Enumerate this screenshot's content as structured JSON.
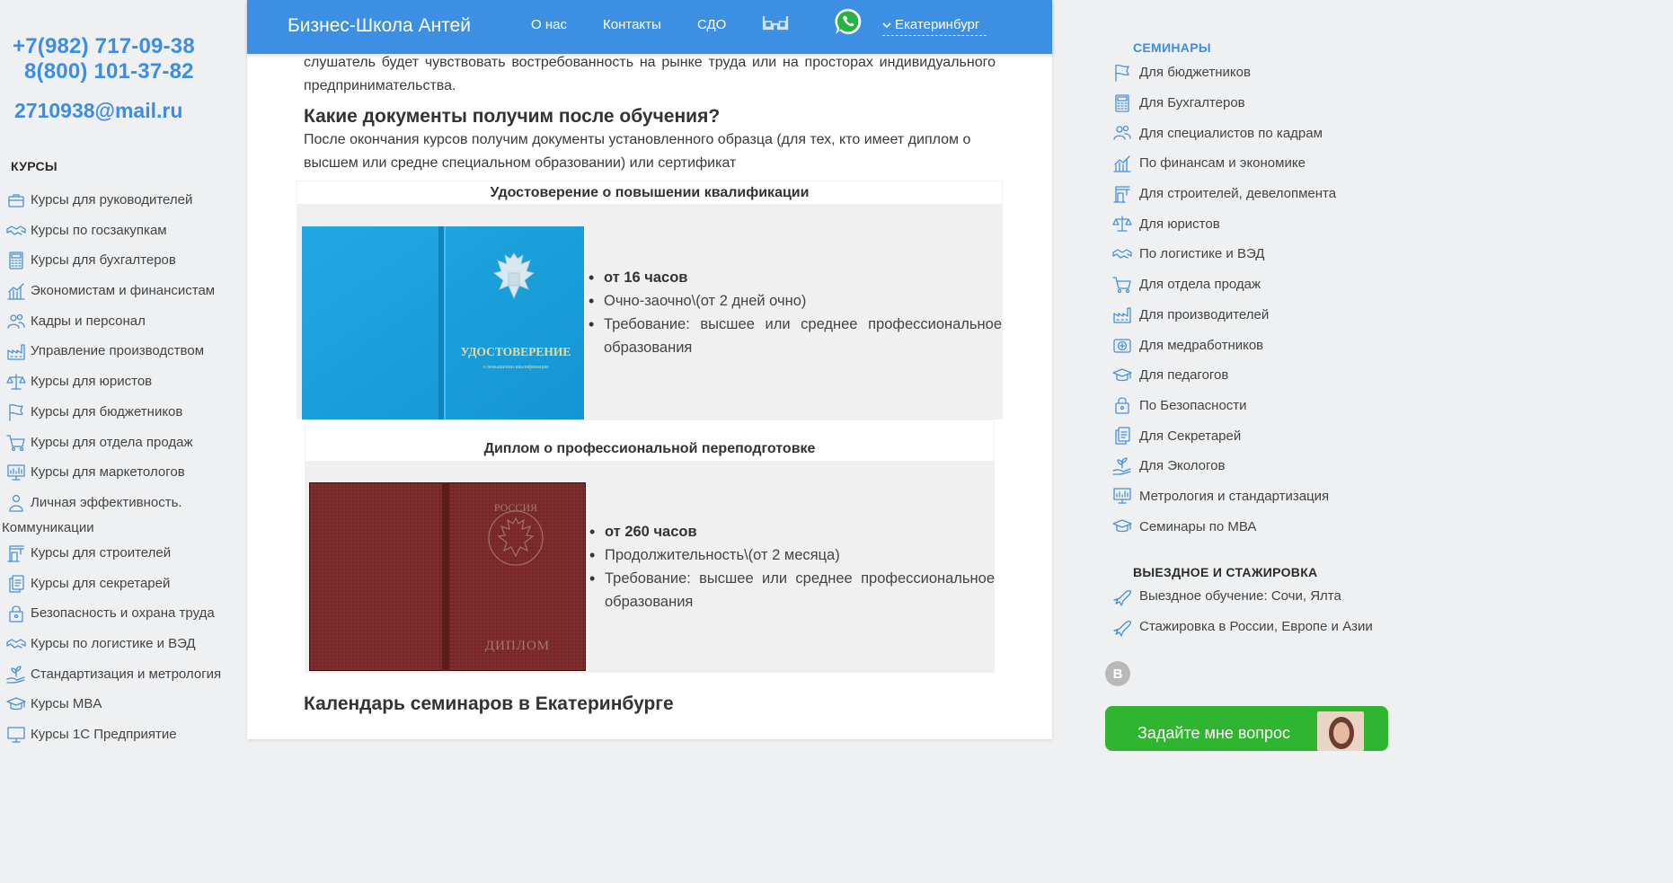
{
  "contacts": {
    "phone1": "+7(982) 717-09-38",
    "phone2": "8(800) 101-37-82",
    "email": "2710938@mail.ru"
  },
  "left_menu": {
    "title": "КУРСЫ",
    "items": [
      {
        "label": "Курсы для руководителей",
        "icon": "briefcase-icon"
      },
      {
        "label": "Курсы по госзакупкам",
        "icon": "handshake-icon"
      },
      {
        "label": "Курсы для бухгалтеров",
        "icon": "calculator-icon"
      },
      {
        "label": "Экономистам и финансистам",
        "icon": "chart-icon"
      },
      {
        "label": "Кадры и персонал",
        "icon": "people-icon"
      },
      {
        "label": "Управление производством",
        "icon": "factory-icon"
      },
      {
        "label": "Курсы для юристов",
        "icon": "scales-icon"
      },
      {
        "label": "Курсы для бюджетников",
        "icon": "flag-icon"
      },
      {
        "label": "Курсы для отдела продаж",
        "icon": "cart-icon"
      },
      {
        "label": "Курсы для маркетологов",
        "icon": "presentation-icon"
      },
      {
        "label": "Личная эффективность.",
        "label2": "Коммуникации",
        "icon": "person-icon"
      },
      {
        "label": "Курсы для строителей",
        "icon": "crane-icon"
      },
      {
        "label": "Курсы для секретарей",
        "icon": "documents-icon"
      },
      {
        "label": "Безопасность и охрана труда",
        "icon": "lock-icon"
      },
      {
        "label": "Курсы по логистике и ВЭД",
        "icon": "handshake-icon"
      },
      {
        "label": "Стандартизация и метрология",
        "icon": "hand-plant-icon"
      },
      {
        "label": "Курсы MBA",
        "icon": "graduation-cap-icon"
      },
      {
        "label": "Курсы 1С Предприятие",
        "icon": "monitor-icon"
      }
    ]
  },
  "header": {
    "brand": "Бизнес-Школа Антей",
    "nav": [
      "О нас",
      "Контакты",
      "СДО"
    ],
    "city": "Екатеринбург"
  },
  "content": {
    "intro": "слушатель будет чувствовать востребованность на рынке труда или на просторах индивидуального предпринимательства.",
    "docs_heading": "Какие документы получим после обучения?",
    "docs_text": "После окончания курсов получим документы установленного образца (для тех, кто имеет диплом о высшем или средне специальном образовании) или сертификат",
    "cert1": {
      "title": "Удостоверение о повышении квалификации",
      "cover_title": "УДОСТОВЕРЕНИЕ",
      "cover_sub": "о повышении квалификации",
      "hours": "от 16 часов",
      "mode": "Очно-заочно\\(от 2 дней очно)",
      "req": "Требование: высшее или среднее профессиональное образования"
    },
    "cert2": {
      "title": "Диплом о профессиональной переподготовке",
      "cover_top": "РОССИЯ",
      "cover_title": "ДИПЛОМ",
      "hours": "от 260 часов",
      "mode": "Продолжительность\\(от 2 месяца)",
      "req": "Требование: высшее или среднее профессиональное образования"
    },
    "calendar_heading": "Календарь семинаров в Екатеринбурге"
  },
  "right_menu": {
    "seminars_title": "СЕМИНАРЫ",
    "seminars": [
      {
        "label": "Для бюджетников",
        "icon": "flag-icon"
      },
      {
        "label": "Для Бухгалтеров",
        "icon": "calculator-icon"
      },
      {
        "label": "Для специалистов по кадрам",
        "icon": "people-icon"
      },
      {
        "label": "По финансам и экономике",
        "icon": "chart-icon"
      },
      {
        "label": "Для строителей, девелопмента",
        "icon": "crane-icon"
      },
      {
        "label": "Для юристов",
        "icon": "scales-icon"
      },
      {
        "label": "По логистике и ВЭД",
        "icon": "handshake-icon"
      },
      {
        "label": "Для отдела продаж",
        "icon": "cart-icon"
      },
      {
        "label": "Для производителей",
        "icon": "factory-icon"
      },
      {
        "label": "Для медработников",
        "icon": "medical-icon"
      },
      {
        "label": "Для педагогов",
        "icon": "graduation-cap-icon"
      },
      {
        "label": "По Безопасности",
        "icon": "lock-icon"
      },
      {
        "label": "Для Секретарей",
        "icon": "documents-icon"
      },
      {
        "label": "Для Экологов",
        "icon": "hand-plant-icon"
      },
      {
        "label": "Метрология и стандартизация",
        "icon": "presentation-icon"
      },
      {
        "label": "Семинары по МВА",
        "icon": "graduation-cap-icon"
      }
    ],
    "trips_title": "ВЫЕЗДНОЕ И СТАЖИРОВКА",
    "trips": [
      {
        "label": "Выездное обучение: Сочи, Ялта",
        "icon": "plane-icon"
      },
      {
        "label": "Стажировка в России, Европе и Азии",
        "icon": "plane-icon"
      }
    ],
    "vk_label": "В",
    "ask_label": "Задайте мне вопрос"
  },
  "colors": {
    "accent": "#3d8fe4",
    "link_blue": "#3d8ee3",
    "cta_green": "#2fb52f",
    "cert_blue": "#1a9fd9",
    "diploma_red": "#7a2a2a"
  }
}
